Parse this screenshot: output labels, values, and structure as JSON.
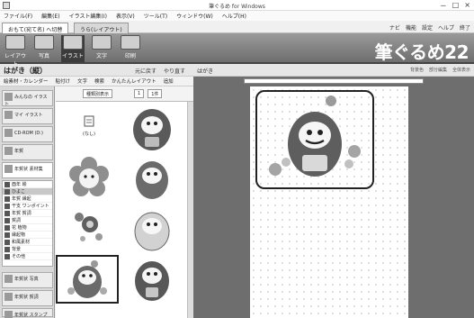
{
  "window": {
    "title": "筆ぐるめ for Windows",
    "controls": [
      "－",
      "□",
      "×"
    ]
  },
  "menu": [
    "ファイル(F)",
    "編集(E)",
    "イラスト編集(I)",
    "表示(V)",
    "ツール(T)",
    "ウィンドウ(W)",
    "ヘルプ(H)"
  ],
  "tabs": [
    {
      "label": "おもて(宛て名) へ切替"
    },
    {
      "label": "うら(レイアウト)"
    }
  ],
  "help_links": [
    "ナビ",
    "機能",
    "設定",
    "ヘルプ",
    "終了"
  ],
  "toolbar": {
    "buttons": [
      {
        "label": "レイアウト"
      },
      {
        "label": "写真"
      },
      {
        "label": "イラスト"
      },
      {
        "label": "文字"
      },
      {
        "label": "印刷"
      }
    ],
    "brand": "筆ぐるめ22"
  },
  "panel": {
    "title": "はがき（縦）",
    "actions": [
      "元に戻す",
      "やり直す"
    ],
    "subtabs": [
      "絵素材・カレンダー",
      "貼付け",
      "文字",
      "検索",
      "かんたんレイアウト",
      "追加"
    ],
    "filter_label": "種類別表示",
    "filter_page": "1",
    "filter_total": "1件",
    "categories": [
      {
        "label": "みんなの イラスト"
      },
      {
        "label": "マイ イラスト"
      },
      {
        "label": "CD-ROM (D:)"
      },
      {
        "label": "年賀"
      },
      {
        "label": "年賀状 素材集"
      }
    ],
    "cat_list": [
      "酉年 絵",
      "ひよこ",
      "年賀 縁起",
      "干支 ワンポイント",
      "年賀 賀詞",
      "賀詞",
      "花 植物",
      "縁起物",
      "和風素材",
      "背景",
      "その他"
    ],
    "cat_buttons_bottom": [
      {
        "label": "年賀状 写真"
      },
      {
        "label": "年賀状 賀詞"
      },
      {
        "label": "年賀状 スタンプ"
      }
    ],
    "thumb_none_label": "(なし)"
  },
  "document": {
    "title": "はがき",
    "tools": [
      "背景色",
      "部分編集",
      "全体表示"
    ]
  }
}
